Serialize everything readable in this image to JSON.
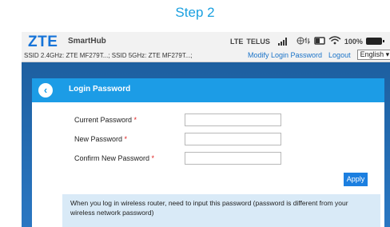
{
  "step_title": "Step 2",
  "header": {
    "logo": "ZTE",
    "product": "SmartHub",
    "ssid": "SSID 2.4GHz: ZTE MF279T...; SSID 5GHz: ZTE MF279T...;",
    "network_type": "LTE",
    "carrier": "TELUS",
    "battery": "100%",
    "icons": [
      "signal-icon",
      "data-icon",
      "battery-icon",
      "wifi-icon"
    ],
    "modify_password_link": "Modify Login Password",
    "logout_link": "Logout",
    "language": "English"
  },
  "panel": {
    "title": "Login Password",
    "fields": [
      {
        "label": "Current Password",
        "required": "*",
        "value": ""
      },
      {
        "label": "New Password",
        "required": "*",
        "value": ""
      },
      {
        "label": "Confirm New Password",
        "required": "*",
        "value": ""
      }
    ],
    "apply_label": "Apply",
    "info_text": "When you log in wireless router, need to input this password (password is different from your wireless network password)"
  },
  "colors": {
    "accent": "#1c9ce6",
    "step_title": "#1aa0e0",
    "link": "#1a73c8",
    "frame": "#1d5fa0"
  }
}
